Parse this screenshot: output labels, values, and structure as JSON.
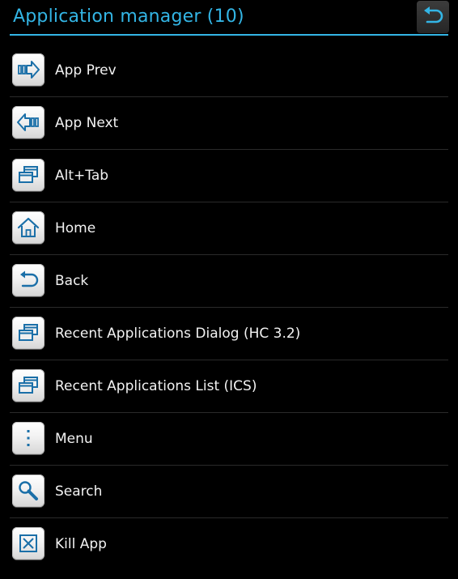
{
  "header": {
    "title": "Application manager (10)",
    "back_icon": "undo-arrow-icon"
  },
  "colors": {
    "accent": "#33b5e5",
    "background": "#000000",
    "text": "#f2f2f2",
    "icon_blue": "#1a6fa8"
  },
  "items": [
    {
      "label": "App Prev",
      "icon": "arrow-right-icon"
    },
    {
      "label": "App Next",
      "icon": "arrow-left-icon"
    },
    {
      "label": "Alt+Tab",
      "icon": "windows-stack-icon"
    },
    {
      "label": "Home",
      "icon": "home-icon"
    },
    {
      "label": "Back",
      "icon": "back-arrow-icon"
    },
    {
      "label": "Recent Applications Dialog (HC 3.2)",
      "icon": "windows-stack-icon"
    },
    {
      "label": "Recent Applications List (ICS)",
      "icon": "windows-stack-icon"
    },
    {
      "label": "Menu",
      "icon": "menu-dots-icon"
    },
    {
      "label": "Search",
      "icon": "search-icon"
    },
    {
      "label": "Kill App",
      "icon": "close-box-icon"
    }
  ]
}
